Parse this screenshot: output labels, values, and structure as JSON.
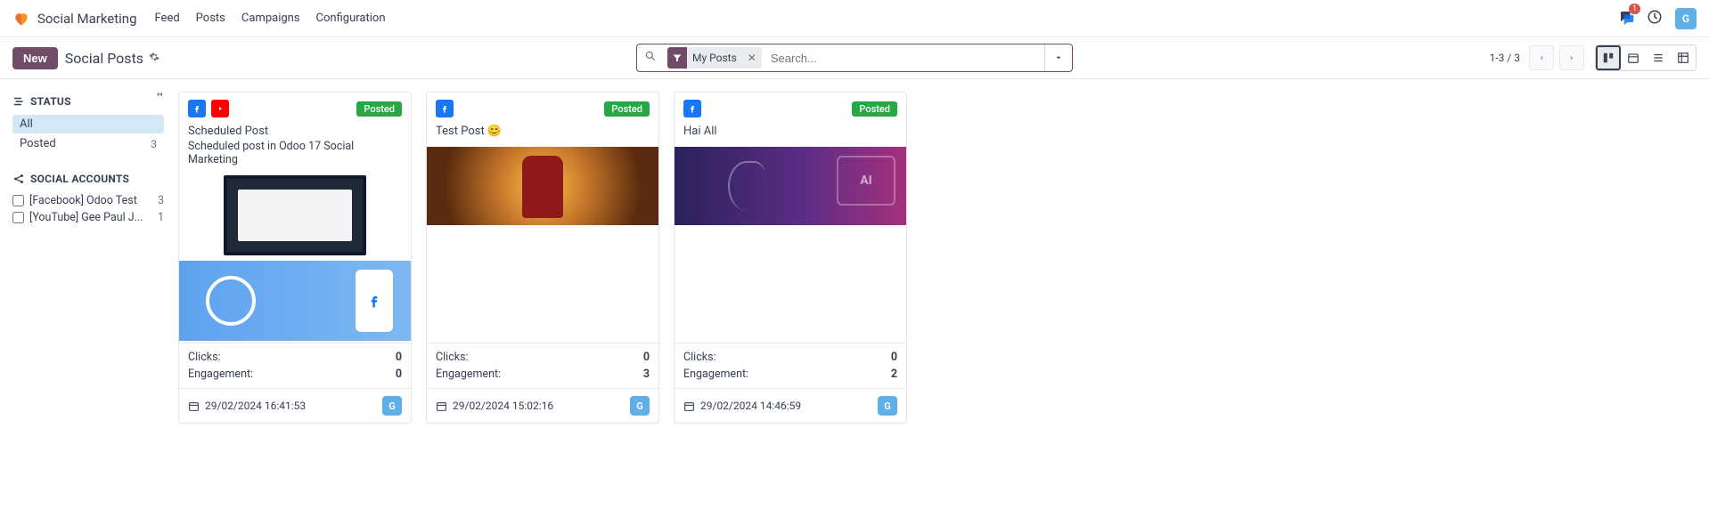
{
  "header": {
    "app_name": "Social Marketing",
    "nav": {
      "feed": "Feed",
      "posts": "Posts",
      "campaigns": "Campaigns",
      "configuration": "Configuration"
    },
    "chat_badge": "1",
    "user_initial": "G"
  },
  "controls": {
    "new_button": "New",
    "page_title": "Social Posts",
    "search_facet": "My Posts",
    "search_placeholder": "Search...",
    "pager": "1-3 / 3"
  },
  "sidebar": {
    "status_title": "STATUS",
    "status_all": "All",
    "status_posted": "Posted",
    "status_posted_count": "3",
    "accounts_title": "SOCIAL ACCOUNTS",
    "accounts": [
      {
        "name": "[Facebook] Odoo Test",
        "count": "3"
      },
      {
        "name": "[YouTube] Gee Paul J...",
        "count": "1"
      }
    ]
  },
  "labels": {
    "clicks": "Clicks:",
    "engagement": "Engagement:"
  },
  "cards": [
    {
      "networks": [
        "fb",
        "yt"
      ],
      "status": "Posted",
      "title": "Scheduled Post",
      "subtitle": "Scheduled post in Odoo 17 Social Marketing",
      "clicks": "0",
      "engagement": "0",
      "datetime": "29/02/2024 16:41:53",
      "author": "G"
    },
    {
      "networks": [
        "fb"
      ],
      "status": "Posted",
      "title": "Test Post 😊",
      "subtitle": "",
      "clicks": "0",
      "engagement": "3",
      "datetime": "29/02/2024 15:02:16",
      "author": "G"
    },
    {
      "networks": [
        "fb"
      ],
      "status": "Posted",
      "title": "Hai All",
      "subtitle": "",
      "clicks": "0",
      "engagement": "2",
      "datetime": "29/02/2024 14:46:59",
      "author": "G"
    }
  ]
}
